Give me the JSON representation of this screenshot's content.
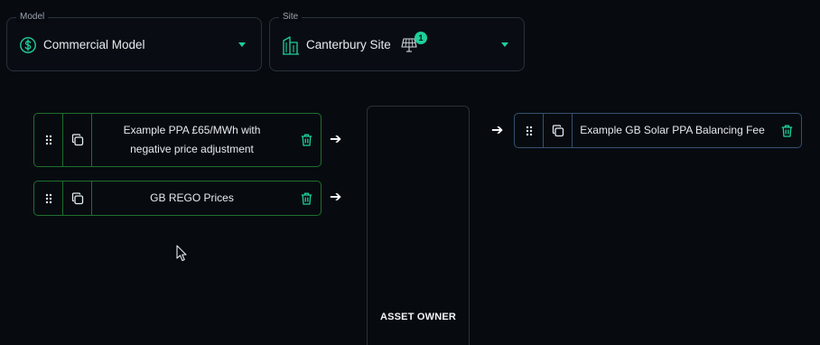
{
  "model_selector": {
    "legend": "Model",
    "value": "Commercial Model",
    "icon": "dollar-circle-icon"
  },
  "site_selector": {
    "legend": "Site",
    "value": "Canterbury Site",
    "icon": "building-icon",
    "site_type_icon": "solar-panel-icon",
    "badge_count": "1"
  },
  "inputs": [
    {
      "label_line1": "Example PPA £65/MWh with",
      "label_line2": "negative price adjustment"
    },
    {
      "label": "GB REGO Prices"
    }
  ],
  "asset_owner": {
    "label": "ASSET OWNER"
  },
  "outputs": [
    {
      "label": "Example GB Solar PPA Balancing Fee"
    }
  ],
  "colors": {
    "background": "#070b10",
    "accent": "#1fcf9a",
    "input_border": "#1f6f2c",
    "output_border": "#35506e",
    "neutral_border": "#2a3038"
  }
}
